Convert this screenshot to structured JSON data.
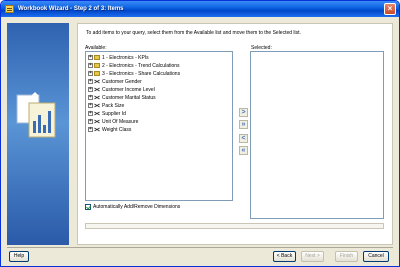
{
  "window": {
    "title": "Workbook Wizard - Step 2 of 3: Items",
    "close_glyph": "×"
  },
  "instructions": "To add items to your query, select them from the Available list and move them to the Selected list.",
  "available": {
    "label": "Available:",
    "items": [
      {
        "label": "1 - Electronics - KPIs",
        "icon": "folder-icon"
      },
      {
        "label": "2 - Electronics - Trend Calculations",
        "icon": "folder-icon"
      },
      {
        "label": "3 - Electronics - Share Calculations",
        "icon": "folder-icon"
      },
      {
        "label": "Customer Gender",
        "icon": "dimension-icon"
      },
      {
        "label": "Customer Income Level",
        "icon": "dimension-icon"
      },
      {
        "label": "Customer Marital Status",
        "icon": "dimension-icon"
      },
      {
        "label": "Pack Size",
        "icon": "dimension-icon"
      },
      {
        "label": "Supplier Id",
        "icon": "dimension-icon"
      },
      {
        "label": "Unit Of Measure",
        "icon": "dimension-icon"
      },
      {
        "label": "Weight Class",
        "icon": "dimension-icon"
      }
    ]
  },
  "selected": {
    "label": "Selected:"
  },
  "move_buttons": {
    "add": ">",
    "add_all": "»",
    "remove": "<",
    "remove_all": "«"
  },
  "auto_dimensions": {
    "label": "Automatically Add/Remove Dimensions",
    "checked": true
  },
  "buttons": {
    "help": "Help",
    "back": "< Back",
    "next": "Next >",
    "finish": "Finish",
    "cancel": "Cancel"
  }
}
